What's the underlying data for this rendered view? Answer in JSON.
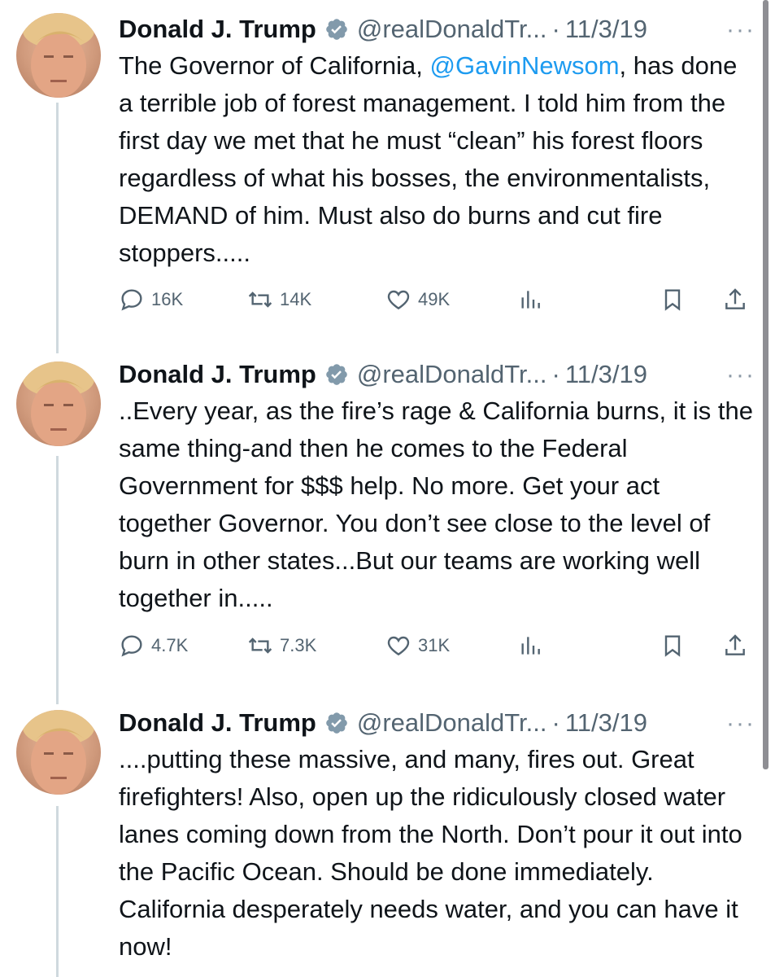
{
  "tweets": [
    {
      "name": "Donald J. Trump",
      "handle": "@realDonaldTr...",
      "separator": "·",
      "date": "11/3/19",
      "more": "···",
      "text_before": "The Governor of California, ",
      "mention": "@GavinNewsom",
      "text_after": ", has done a terrible job of forest management. I told him from the first day we met that he must “clean” his forest floors regardless of what his bosses, the environmentalists, DEMAND of him. Must also do burns and cut fire stoppers.....",
      "replies": "16K",
      "retweets": "14K",
      "likes": "49K"
    },
    {
      "name": "Donald J. Trump",
      "handle": "@realDonaldTr...",
      "separator": "·",
      "date": "11/3/19",
      "more": "···",
      "text_before": "..Every year, as the fire’s rage & California burns, it is the same thing-and then he comes to the Federal Government for $$$ help. No more. Get your act together Governor. You don’t see close to the level of burn in other states...But our teams are working well together in.....",
      "mention": "",
      "text_after": "",
      "replies": "4.7K",
      "retweets": "7.3K",
      "likes": "31K"
    },
    {
      "name": "Donald J. Trump",
      "handle": "@realDonaldTr...",
      "separator": "·",
      "date": "11/3/19",
      "more": "···",
      "text_before": "....putting these massive, and many, fires out. Great firefighters! Also, open up the ridiculously closed water lanes coming down from the North. Don’t pour it out into the Pacific Ocean. Should be done immediately. California desperately needs water, and you can have it now!",
      "mention": "",
      "text_after": ""
    }
  ],
  "colors": {
    "link": "#1d9bf0",
    "secondary_text": "#536471",
    "thread_line": "#cfd9de",
    "verified_badge": "#829aab"
  },
  "icons": [
    "reply-icon",
    "retweet-icon",
    "like-icon",
    "views-icon",
    "bookmark-icon",
    "share-icon",
    "verified-badge-icon",
    "more-icon"
  ]
}
